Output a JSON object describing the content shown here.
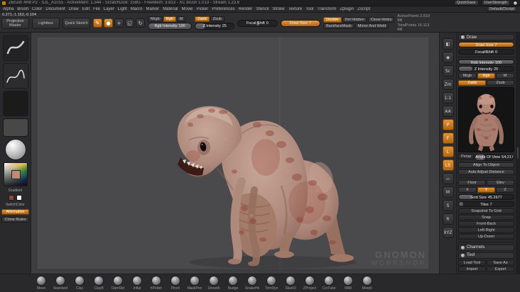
{
  "titlebar": {
    "title": "ZBrush 4R8 P2 - SJL_A1015 - ActiveMem: 1.344 - ScratchDisk: 158G - FreeMem: 3.813 - XC brush 1.013 - Stream 1.23.6",
    "quicksave": "QuickSave",
    "user_strength": "UserStrength"
  },
  "menubar": {
    "items": [
      "Alpha",
      "Brush",
      "Color",
      "Document",
      "Draw",
      "Edit",
      "File",
      "Layer",
      "Light",
      "Macro",
      "Marker",
      "Material",
      "Movie",
      "Picker",
      "Preferences",
      "Render",
      "Stencil",
      "Stroke",
      "Texture",
      "Tool",
      "Transform",
      "Zplugin",
      "Zscript"
    ],
    "right_chip": "DefaultZScript"
  },
  "toolbar": {
    "coords": "0.271,-1.162,-0.104",
    "projection_master": "Projection Master",
    "lightbox": "Lightbox",
    "quick_sketch": "Quick Sketch",
    "mode_buttons": {
      "edit": {
        "glyph": "✎",
        "label": "Edit"
      },
      "draw": {
        "glyph": "●",
        "label": "Draw"
      },
      "move": {
        "glyph": "+",
        "label": "Move"
      },
      "scale": {
        "glyph": "◱",
        "label": "Scale"
      },
      "rotate": {
        "glyph": "↻",
        "label": "Rotate"
      }
    },
    "paint_toggles": {
      "mrgb": "Mrgb",
      "rgb": "Rgb",
      "m": "M"
    },
    "rgb_intensity": {
      "label": "Rgb Intensity",
      "value": "100"
    },
    "sculpt_toggles": {
      "zadd": "Zadd",
      "zsub": "Zsub"
    },
    "z_intensity": {
      "label": "Z Intensity",
      "value": "25"
    },
    "focal_shift": {
      "label": "Focal Shift",
      "value": "0"
    },
    "draw_size": {
      "label": "Draw Size",
      "value": "7"
    },
    "geo_buttons": {
      "double": "Double",
      "del_hidden": "Del Hidden",
      "close_holes": "Close Holes",
      "backface_mask": "BackfaceMask",
      "mirror_and_weld": "Mirror And Weld"
    },
    "active_points": "ActivePoints 2.819 Mil",
    "total_points": "TotalPoints 16.113 Mil"
  },
  "left_tray": {
    "gradient_label": "Gradient",
    "switch_color": "SwitchColor",
    "alt_button": "Alternative",
    "clone_button": "Clone Rules",
    "main_color": "#8a4a3c",
    "secondary_color": "#ffffff"
  },
  "right_shelf": {
    "icons": [
      {
        "glyph": "◧",
        "name": "bpr-render"
      },
      {
        "glyph": "◉",
        "name": "render-mode"
      },
      {
        "glyph": "Sc",
        "name": "scroll"
      },
      {
        "glyph": "Zm",
        "name": "zoom"
      },
      {
        "glyph": "1:1",
        "name": "actual-size"
      },
      {
        "glyph": "AA",
        "name": "aa-half"
      },
      {
        "glyph": "P",
        "name": "persp",
        "active": true
      },
      {
        "glyph": "F",
        "name": "floor",
        "active": true
      },
      {
        "glyph": "L",
        "name": "local",
        "active": true
      },
      {
        "glyph": "LS",
        "name": "lsym",
        "active": true
      },
      {
        "glyph": "▭",
        "name": "frame"
      },
      {
        "glyph": "M",
        "name": "move"
      },
      {
        "glyph": "S",
        "name": "scale"
      },
      {
        "glyph": "R",
        "name": "rotate"
      },
      {
        "glyph": "XYZ",
        "name": "xyz"
      }
    ]
  },
  "right_tray": {
    "header": "Draw",
    "draw_size": {
      "label": "Draw Size",
      "value": "7"
    },
    "focal_shift": {
      "label": "Focal Shift",
      "value": "0"
    },
    "rgb_intensity": {
      "label": "Rgb Intensity",
      "value": "100"
    },
    "z_intensity": {
      "label": "Z Intensity",
      "value": "25"
    },
    "paint_toggles": {
      "mrgb": "Mrgb",
      "rgb": "Rgb",
      "m": "M"
    },
    "sculpt_toggles": {
      "zadd": "Zadd",
      "zsub": "Zsub"
    },
    "persp_chip": "Persp",
    "angle_of_view": {
      "label": "Angle Of View",
      "value": "54.217"
    },
    "align_to_object": "Align To Object",
    "auto_adjust": "Auto Adjust Distance",
    "floor_btn": "Floor",
    "elev_btn": "Elev",
    "axes": [
      {
        "label": "X"
      },
      {
        "label": "Y",
        "active": true
      },
      {
        "label": "Z"
      }
    ],
    "grid_size": {
      "label": "Grid Size",
      "value": "45.2677"
    },
    "tiles": {
      "label": "Tiles",
      "value": "7"
    },
    "floor_buttons": [
      "Snapshot To Grid",
      "Snap",
      "Front-Back",
      "Left-Right",
      "Up-Down"
    ],
    "channels_header": "Channels",
    "tool_header": "Tool",
    "tool_buttons": [
      "Load Tool",
      "Save As",
      "Import",
      "Export"
    ]
  },
  "canvas": {
    "watermark_line1": "GNOMON",
    "watermark_line2": "WORKSHOP"
  },
  "dock": {
    "items": [
      {
        "label": "Move"
      },
      {
        "label": "Standard"
      },
      {
        "label": "Clay"
      },
      {
        "label": "ClayB"
      },
      {
        "label": "DamStd"
      },
      {
        "label": "Inflat"
      },
      {
        "label": "hPolish"
      },
      {
        "label": "Pinch"
      },
      {
        "label": "MaskPen"
      },
      {
        "label": "Smooth"
      },
      {
        "label": "Nudge"
      },
      {
        "label": "SnakeHk"
      },
      {
        "label": "TrimDyn"
      },
      {
        "label": "Slash2"
      },
      {
        "label": "ZProject"
      },
      {
        "label": "CrvTube"
      },
      {
        "label": "IMM"
      },
      {
        "label": "Morph"
      }
    ]
  },
  "colors": {
    "accent_orange": "#c9781f",
    "canvas_bg": "#4a4a4d",
    "panel_bg": "#2a2a2c"
  }
}
